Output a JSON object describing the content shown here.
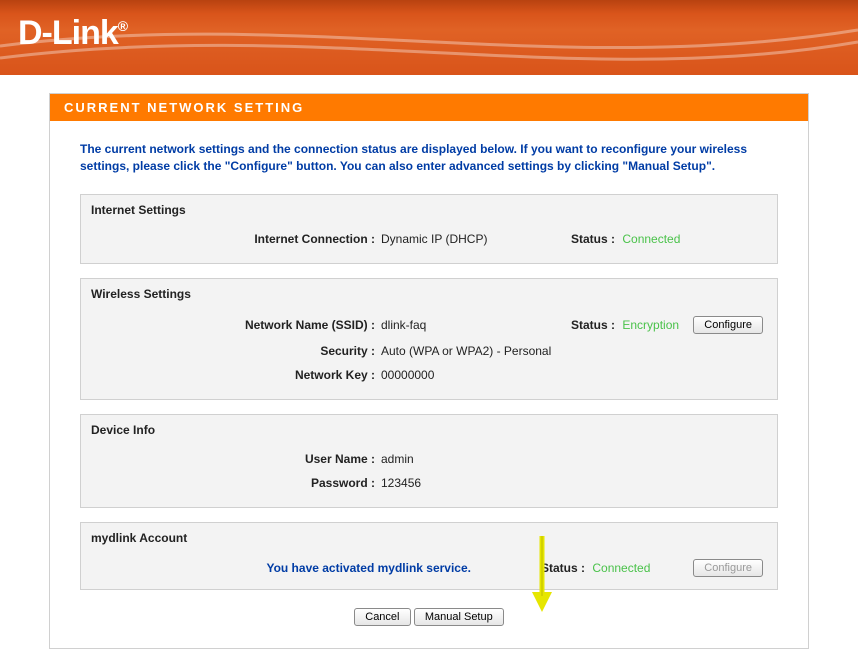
{
  "brand": "D-Link",
  "pageTitle": "CURRENT NETWORK SETTING",
  "intro": "The current network settings and the connection status are displayed below. If you want to reconfigure your wireless settings, please click the \"Configure\" button. You can also enter advanced settings by clicking \"Manual Setup\".",
  "internet": {
    "title": "Internet Settings",
    "connLabel": "Internet Connection :",
    "connValue": "Dynamic IP (DHCP)",
    "statusLabel": "Status :",
    "statusValue": "Connected"
  },
  "wireless": {
    "title": "Wireless Settings",
    "ssidLabel": "Network Name (SSID) :",
    "ssidValue": "dlink-faq",
    "statusLabel": "Status :",
    "statusValue": "Encryption",
    "configureLabel": "Configure",
    "securityLabel": "Security :",
    "securityValue": "Auto (WPA or WPA2) - Personal",
    "keyLabel": "Network Key :",
    "keyValue": "00000000"
  },
  "device": {
    "title": "Device Info",
    "userLabel": "User Name :",
    "userValue": "admin",
    "passLabel": "Password :",
    "passValue": "123456"
  },
  "mydlink": {
    "title": "mydlink Account",
    "message": "You have activated mydlink service.",
    "statusLabel": "Status :",
    "statusValue": "Connected",
    "configureLabel": "Configure"
  },
  "bottom": {
    "cancelLabel": "Cancel",
    "manualLabel": "Manual Setup"
  }
}
